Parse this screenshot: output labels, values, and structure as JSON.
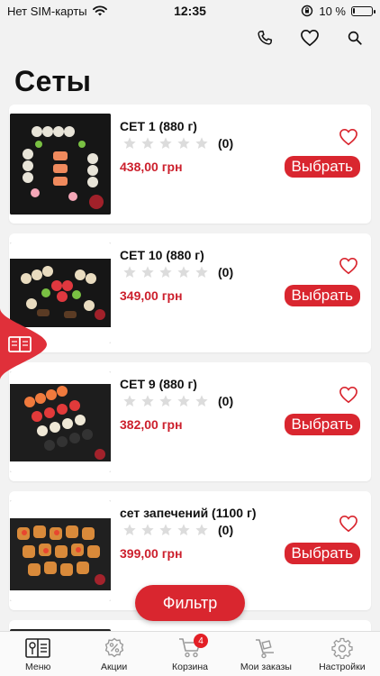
{
  "status_bar": {
    "carrier": "Нет SIM-карты",
    "time": "12:35",
    "battery_text": "10 %",
    "battery_level": 0.1
  },
  "header": {
    "title": "Сеты"
  },
  "products": [
    {
      "name": "СЕТ 1 (880 г)",
      "rating_count": "(0)",
      "price": "438,00 грн",
      "button": "Выбрать"
    },
    {
      "name": "СЕТ 10 (880 г)",
      "rating_count": "(0)",
      "price": "349,00 грн",
      "button": "Выбрать"
    },
    {
      "name": "СЕТ 9 (880 г)",
      "rating_count": "(0)",
      "price": "382,00 грн",
      "button": "Выбрать"
    },
    {
      "name": "сет запечений (1100 г)",
      "rating_count": "(0)",
      "price": "399,00 грн",
      "button": "Выбрать"
    }
  ],
  "filter_button": "Фильтр",
  "tabbar": {
    "items": [
      {
        "label": "Меню",
        "icon": "menu-book-icon"
      },
      {
        "label": "Акции",
        "icon": "discount-badge-icon"
      },
      {
        "label": "Корзина",
        "icon": "cart-icon",
        "badge": "4"
      },
      {
        "label": "Мои заказы",
        "icon": "delivery-cart-icon"
      },
      {
        "label": "Настройки",
        "icon": "gear-icon"
      }
    ]
  },
  "colors": {
    "accent": "#d9262f",
    "price": "#cc1f2c",
    "star_empty": "#dcdcdc"
  }
}
